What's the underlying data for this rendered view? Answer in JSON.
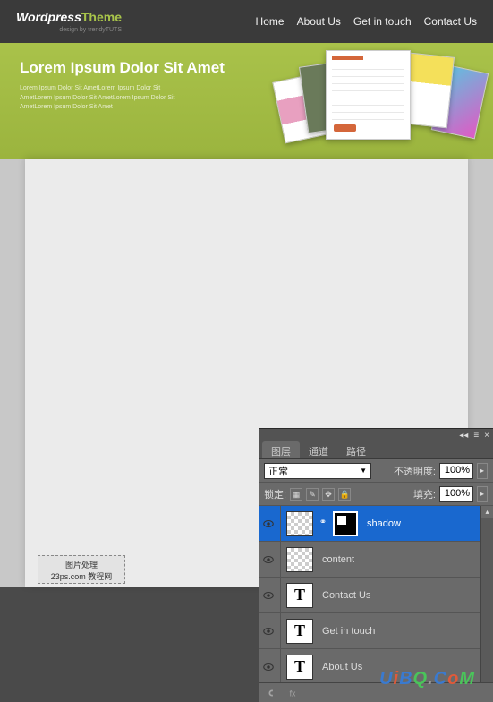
{
  "logo": {
    "word1": "Wordpress",
    "word2": "Theme",
    "tagline": "design by trendyTUTS"
  },
  "nav": [
    "Home",
    "About Us",
    "Get in touch",
    "Contact Us"
  ],
  "hero": {
    "title": "Lorem Ipsum Dolor Sit Amet",
    "sub": "Lorem Ipsum Dolor Sit AmetLorem Ipsum Dolor Sit\nAmetLorem Ipsum Dolor Sit AmetLorem Ipsum Dolor Sit\nAmetLorem Ipsum Dolor Sit Amet"
  },
  "stamp": {
    "line1": "图片处理",
    "line2": "23ps.com 教程网"
  },
  "ps": {
    "tabs": [
      "图层",
      "通道",
      "路径"
    ],
    "blend_mode": "正常",
    "opacity_label": "不透明度:",
    "opacity_value": "100%",
    "lock_label": "锁定:",
    "fill_label": "填充:",
    "fill_value": "100%",
    "layers": [
      {
        "name": "shadow",
        "type": "mask",
        "selected": true
      },
      {
        "name": "content",
        "type": "trans",
        "selected": false
      },
      {
        "name": "Contact Us",
        "type": "text",
        "selected": false
      },
      {
        "name": "Get in touch",
        "type": "text",
        "selected": false
      },
      {
        "name": "About Us",
        "type": "text",
        "selected": false
      }
    ]
  },
  "watermark": "UiBQ.CoM"
}
